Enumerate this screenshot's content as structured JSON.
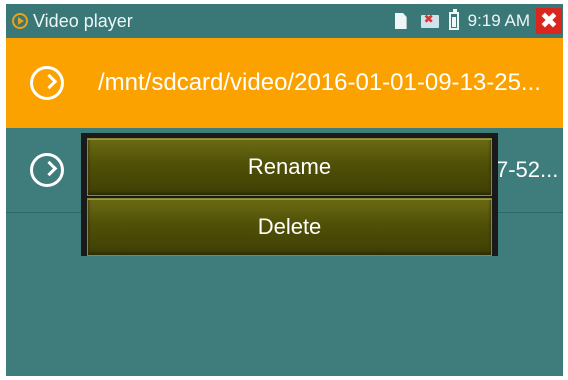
{
  "status_bar": {
    "app_title": "Video player",
    "time": "9:19 AM",
    "close_label": "✖"
  },
  "file_list": [
    {
      "path": "/mnt/sdcard/video/2016-01-01-09-13-25...",
      "selected": true
    },
    {
      "path": "7-52...",
      "selected": false
    }
  ],
  "context_menu": {
    "items": [
      "Rename",
      "Delete"
    ]
  }
}
